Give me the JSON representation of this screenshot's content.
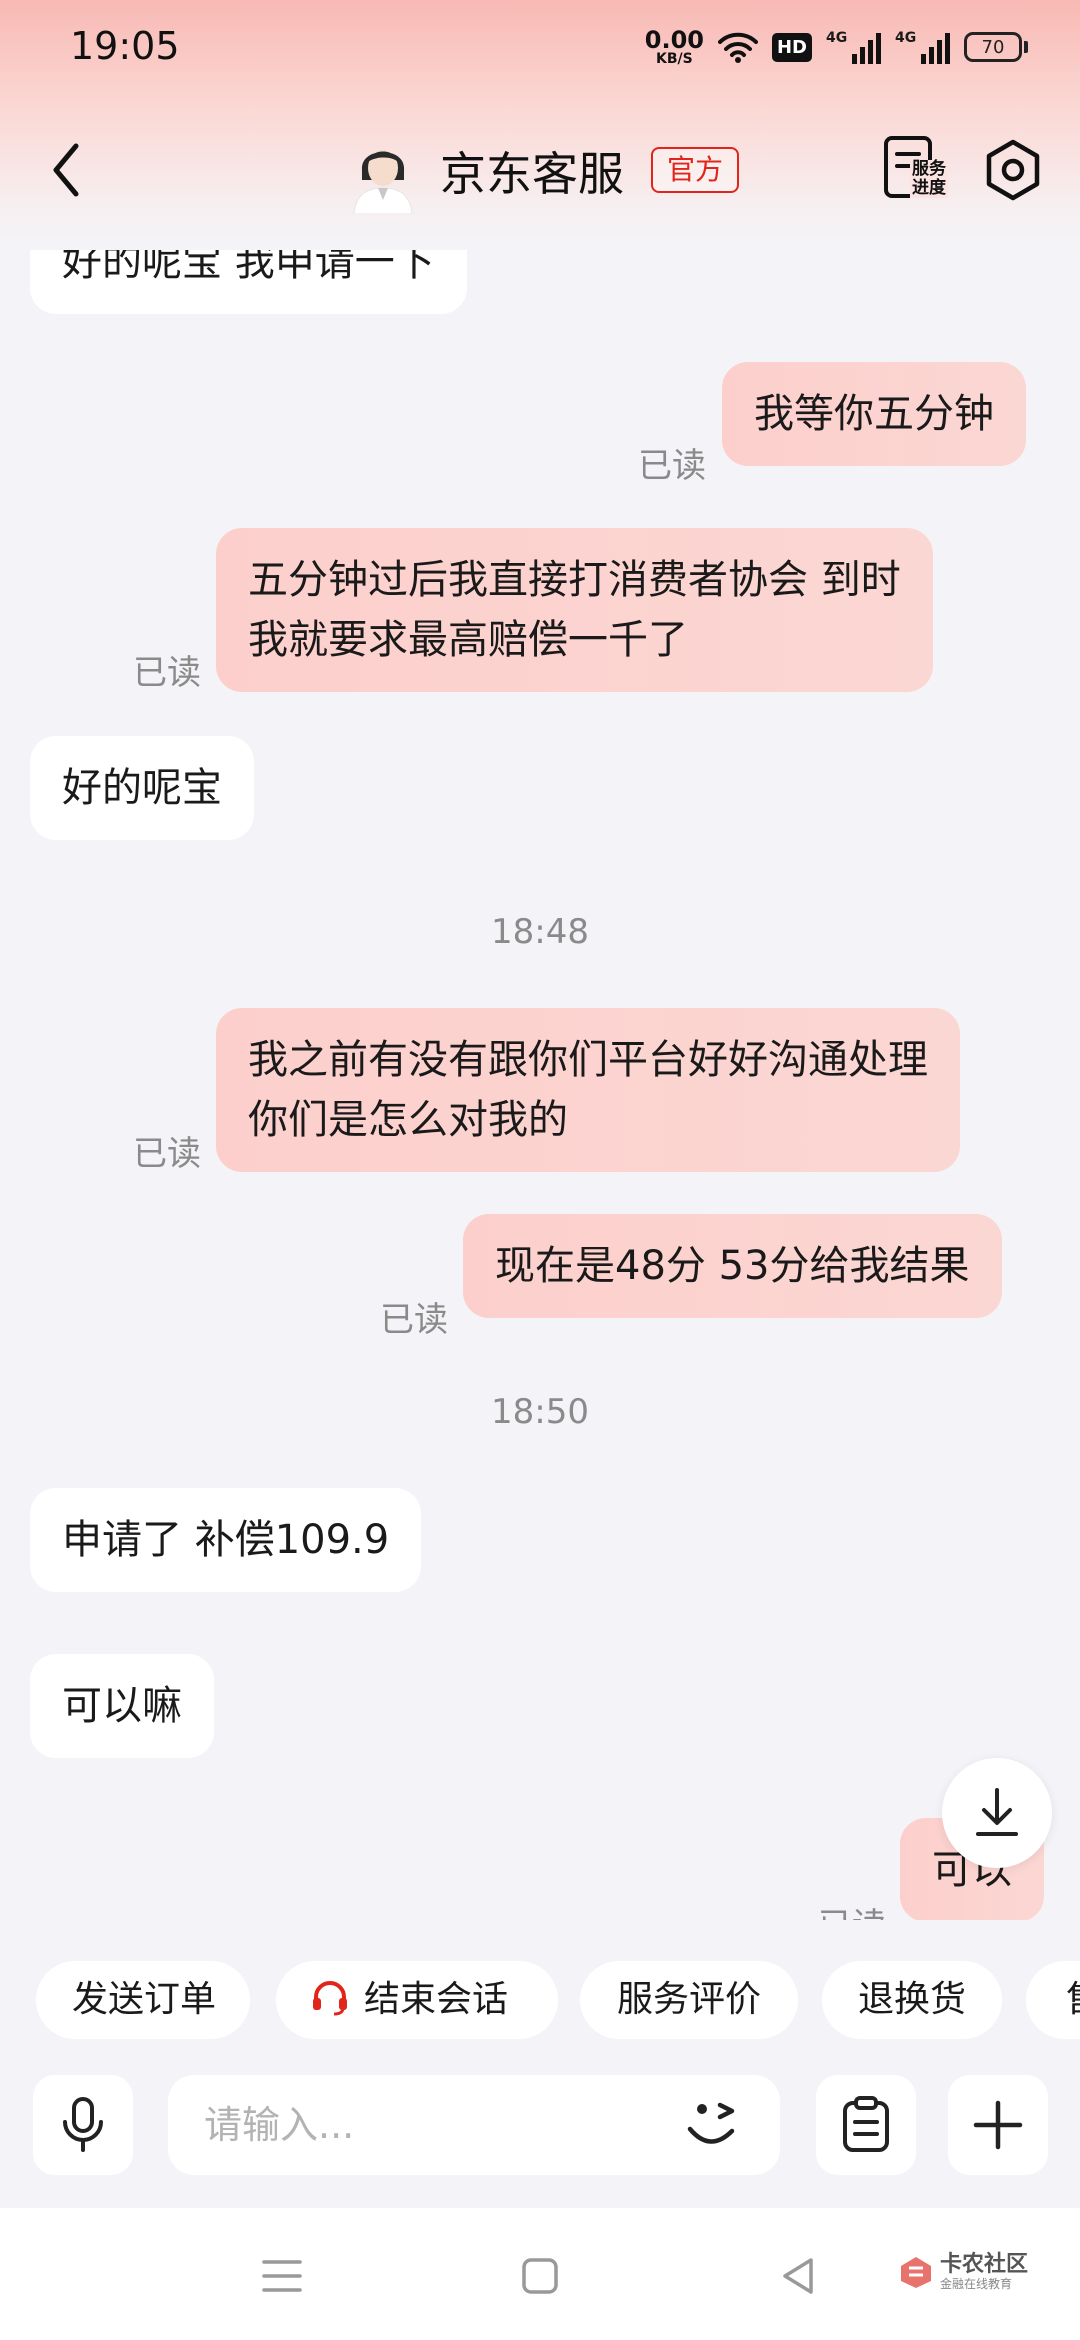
{
  "status_bar": {
    "time": "19:05",
    "net_speed_value": "0.00",
    "net_speed_unit": "KB/S",
    "hd_label": "HD",
    "signal_1_label": "4G",
    "signal_2_label": "4G",
    "battery_level": "70"
  },
  "header": {
    "title": "京东客服",
    "badge": "官方",
    "service_progress_label": "服务进度"
  },
  "messages": [
    {
      "side": "recv",
      "text": "好的呢宝 我申请一下"
    },
    {
      "side": "sent",
      "text": "我等你五分钟",
      "read_label": "已读"
    },
    {
      "side": "sent",
      "line1": "五分钟过后我直接打消费者协会  到时",
      "line2": "我就要求最高赔偿一千了",
      "read_label": "已读"
    },
    {
      "side": "recv",
      "text": "好的呢宝"
    },
    {
      "type": "timestamp",
      "text": "18:48"
    },
    {
      "side": "sent",
      "line1": "我之前有没有跟你们平台好好沟通处理",
      "line2": "你们是怎么对我的",
      "read_label": "已读"
    },
    {
      "side": "sent",
      "text": "现在是48分  53分给我结果",
      "read_label": "已读"
    },
    {
      "type": "timestamp",
      "text": "18:50"
    },
    {
      "side": "recv",
      "text": "申请了 补偿109.9"
    },
    {
      "side": "recv",
      "text": "可以嘛"
    },
    {
      "side": "sent",
      "text": "可以",
      "read_label": "已读"
    }
  ],
  "quick_actions": [
    {
      "label": "发送订单"
    },
    {
      "label": "结束会话"
    },
    {
      "label": "服务评价"
    },
    {
      "label": "退换货"
    },
    {
      "label": "售"
    }
  ],
  "input": {
    "placeholder": "请输入..."
  },
  "watermark": {
    "name": "卡农社区",
    "tagline": "金融在线教育"
  },
  "colors": {
    "accent_red": "#e1251b",
    "sent_bubble": "#fcd2ce",
    "received_bubble": "#ffffff",
    "background": "#f4f4f8"
  }
}
